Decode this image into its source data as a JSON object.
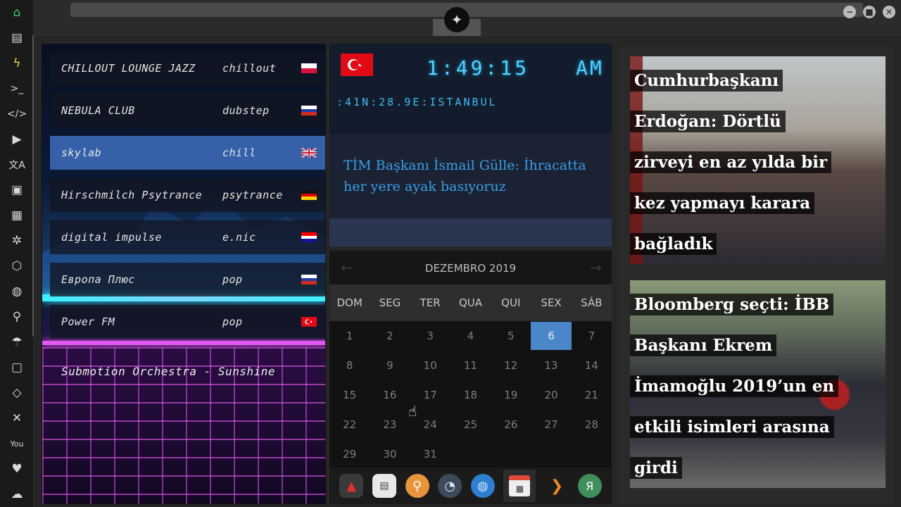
{
  "rail": {
    "icons": [
      "home-icon",
      "document-icon",
      "bolt-icon",
      "terminal-icon",
      "code-icon",
      "play-icon",
      "translate-icon",
      "image-icon",
      "news-icon",
      "aperture-icon",
      "hexagon-icon",
      "globe-icon",
      "search-icon",
      "umbrella-icon",
      "contact-icon",
      "code-brackets-icon",
      "expand-icon",
      "youtube-icon",
      "heart-icon",
      "cloud-icon"
    ]
  },
  "radio": {
    "stations": [
      {
        "name": "CHILLOUT LOUNGE JAZZ",
        "genre": "chillout",
        "flag": "pl"
      },
      {
        "name": "NEBULA CLUB",
        "genre": "dubstep",
        "flag": "ru"
      },
      {
        "name": "skylab",
        "genre": "chill",
        "flag": "gb",
        "selected": true
      },
      {
        "name": "Hirschmilch Psytrance",
        "genre": "psytrance",
        "flag": "de"
      },
      {
        "name": "digital impulse",
        "genre": "e.nic",
        "flag": "hr"
      },
      {
        "name": "Европа Плюс",
        "genre": "pop",
        "flag": "ru"
      },
      {
        "name": "Power FM",
        "genre": "pop",
        "flag": "tr"
      }
    ],
    "now_playing": "Submotion Orchestra - Sunshine"
  },
  "clock": {
    "time": "1:49:15",
    "ampm": "AM",
    "location": ":41N:28.9E:ISTANBUL",
    "flag": "tr"
  },
  "ticker": {
    "headline": "TİM Başkanı İsmail Gülle: İhracatta her yere ayak basıyoruz"
  },
  "calendar": {
    "month": "DEZEMBRO 2019",
    "weekdays": [
      "DOM",
      "SEG",
      "TER",
      "QUA",
      "QUI",
      "SEX",
      "SÁB"
    ],
    "days": [
      "1",
      "2",
      "3",
      "4",
      "5",
      "6",
      "7",
      "8",
      "9",
      "10",
      "11",
      "12",
      "13",
      "14",
      "15",
      "16",
      "17",
      "18",
      "19",
      "20",
      "21",
      "22",
      "23",
      "24",
      "25",
      "26",
      "27",
      "28",
      "29",
      "30",
      "31"
    ],
    "today": "6"
  },
  "dock": {
    "items": [
      "launcher-icon",
      "newspaper-icon",
      "search-app-icon",
      "clock-app-icon",
      "globe-app-icon",
      "calendar-app-icon",
      "next-arrow-icon",
      "yandex-icon"
    ],
    "active": "calendar-app-icon"
  },
  "news": [
    {
      "lines": [
        "Cumhurbaşkanı",
        "Erdoğan: Dörtlü",
        "zirveyi en az yılda bir",
        "kez yapmayı karara",
        "bağladık"
      ]
    },
    {
      "lines": [
        "Bloomberg seçti: İBB",
        "Başkanı Ekrem",
        "İmamoğlu 2019’un en",
        "etkili isimleri arasına",
        "girdi"
      ]
    }
  ],
  "colors": {
    "accent": "#4a86c8",
    "clock": "#4fd2ff",
    "ticker_text": "#3a9fe8",
    "rail_active": "#3fcf66"
  }
}
